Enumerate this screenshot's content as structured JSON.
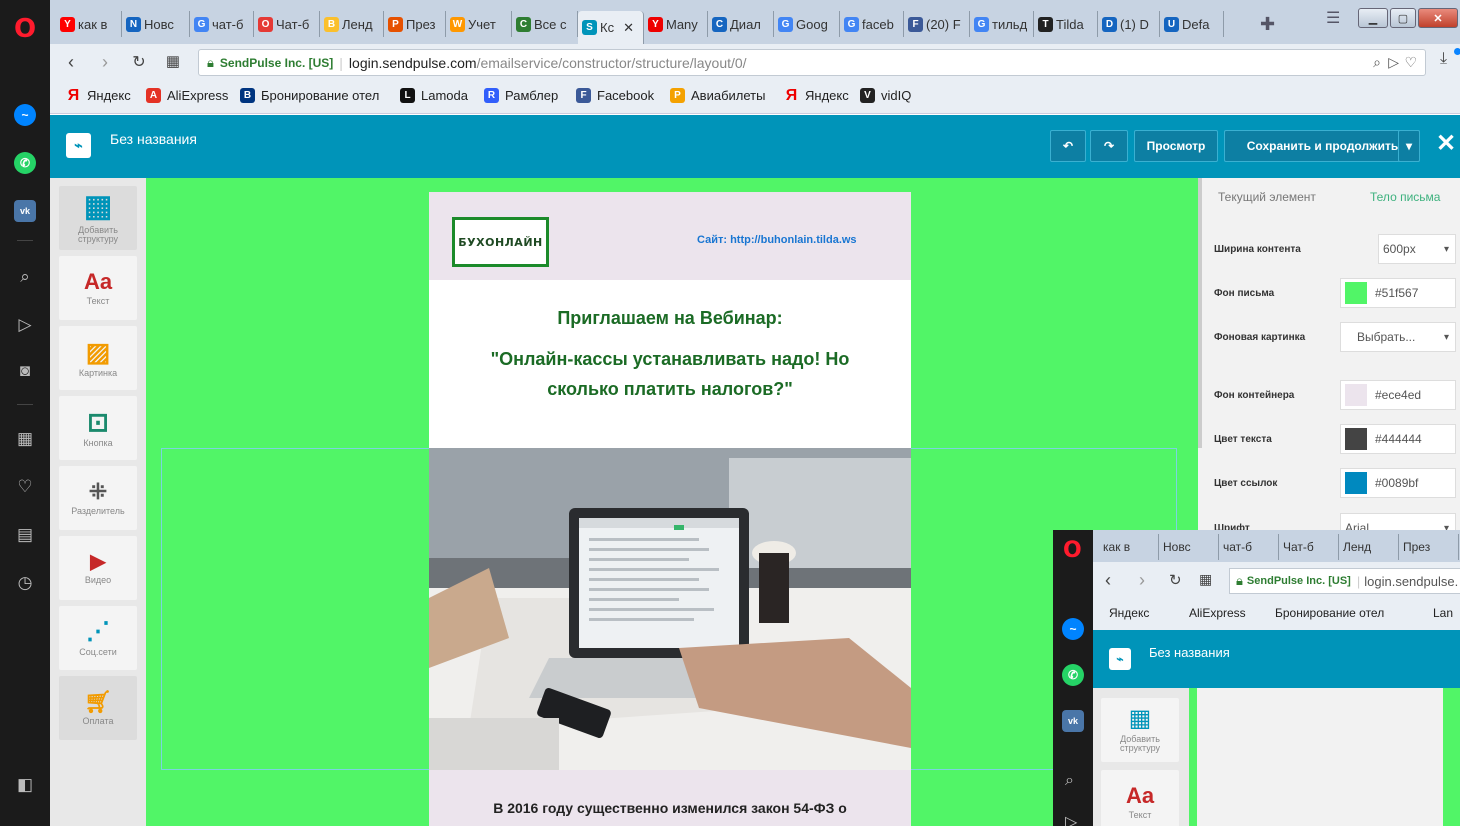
{
  "tabs": [
    {
      "label": "как в",
      "fav": "yandex-icon",
      "color": "#ff0000"
    },
    {
      "label": "Новс",
      "fav": "news-icon",
      "color": "#1565c0"
    },
    {
      "label": "чат-б",
      "fav": "google-icon",
      "color": "#4285f4"
    },
    {
      "label": "Чат-б",
      "fav": "opera-icon",
      "color": "#e53935"
    },
    {
      "label": "Ленд",
      "fav": "bulb-icon",
      "color": "#fbc02d"
    },
    {
      "label": "През",
      "fav": "presentation-icon",
      "color": "#e65100"
    },
    {
      "label": "Учет",
      "fav": "windows-icon",
      "color": "#ff9800"
    },
    {
      "label": "Все с",
      "fav": "check-icon",
      "color": "#2e7d32"
    },
    {
      "label": "Кс",
      "fav": "sendpulse-icon",
      "color": "#0094b9"
    },
    {
      "label": "Many",
      "fav": "youtube-icon",
      "color": "#e00"
    },
    {
      "label": "Диал",
      "fav": "chat-icon",
      "color": "#1565c0"
    },
    {
      "label": "Goog",
      "fav": "google-ads-icon",
      "color": "#4285f4"
    },
    {
      "label": "faceb",
      "fav": "google-icon",
      "color": "#4285f4"
    },
    {
      "label": "(20) F",
      "fav": "facebook-icon",
      "color": "#3b5998"
    },
    {
      "label": "тильд",
      "fav": "google-icon",
      "color": "#4285f4"
    },
    {
      "label": "Tilda",
      "fav": "tilda-icon",
      "color": "#222"
    },
    {
      "label": "(1) D",
      "fav": "doc-icon",
      "color": "#1565c0"
    },
    {
      "label": "Defa",
      "fav": "users-icon",
      "color": "#1565c0"
    }
  ],
  "address": {
    "secure_label": "SendPulse Inc. [US]",
    "url_host": "login.sendpulse.com",
    "url_path": "/emailservice/constructor/structure/layout/0/"
  },
  "bookmarks": [
    {
      "label": "Яндекс",
      "icon": "yandex-icon"
    },
    {
      "label": "AliExpress",
      "icon": "aliexpress-icon"
    },
    {
      "label": "Бронирование отел",
      "icon": "booking-icon"
    },
    {
      "label": "Lamoda",
      "icon": "lamoda-icon"
    },
    {
      "label": "Рамблер",
      "icon": "rambler-icon"
    },
    {
      "label": "Facebook",
      "icon": "facebook-icon"
    },
    {
      "label": "Авиабилеты",
      "icon": "plane-icon"
    },
    {
      "label": "Яндекс",
      "icon": "yandex-icon"
    },
    {
      "label": "vidIQ",
      "icon": "vidiq-icon"
    }
  ],
  "app": {
    "title": "Без названия",
    "undo": "↶",
    "redo": "↷",
    "preview": "Просмотр",
    "save": "Сохранить и продолжить",
    "close": "✕"
  },
  "tools": [
    {
      "label": "Добавить структуру",
      "icon": "grid-icon"
    },
    {
      "label": "Текст",
      "icon": "text-icon"
    },
    {
      "label": "Картинка",
      "icon": "image-icon"
    },
    {
      "label": "Кнопка",
      "icon": "button-icon"
    },
    {
      "label": "Разделитель",
      "icon": "divider-icon"
    },
    {
      "label": "Видео",
      "icon": "video-icon"
    },
    {
      "label": "Соц.сети",
      "icon": "share-icon"
    },
    {
      "label": "Оплата",
      "icon": "cart-icon"
    }
  ],
  "email": {
    "logo": "БУХОНЛАЙН",
    "site": "Сайт: http://buhonlain.tilda.ws",
    "heading1": "Приглашаем на Вебинар:",
    "heading2": "\"Онлайн-кассы устанавливать надо! Но сколько платить налогов?\"",
    "footer_text": "В 2016 году существенно изменился закон 54-ФЗ о"
  },
  "panel": {
    "tab_current": "Текущий элемент",
    "tab_body": "Тело письма",
    "rows": [
      {
        "label": "Ширина контента",
        "value": "600px"
      },
      {
        "label": "Фон письма",
        "value": "#51f567",
        "color": "#51f567"
      },
      {
        "label": "Фоновая картинка",
        "value": "Выбрать..."
      },
      {
        "label": "Фон контейнера",
        "value": "#ece4ed",
        "color": "#ece4ed"
      },
      {
        "label": "Цвет текста",
        "value": "#444444",
        "color": "#444444"
      },
      {
        "label": "Цвет ссылок",
        "value": "#0089bf",
        "color": "#0089bf"
      },
      {
        "label": "Шрифт",
        "value": "Arial"
      }
    ]
  },
  "mini": {
    "tabs": [
      "как в",
      "Новс",
      "чат-б",
      "Чат-б",
      "Ленд",
      "През"
    ],
    "secure_label": "SendPulse Inc. [US]",
    "url": "login.sendpulse.",
    "bookmarks": [
      "Яндекс",
      "AliExpress",
      "Бронирование отел",
      "Lan"
    ],
    "title": "Без названия",
    "tool1": "Добавить структуру",
    "tool2": "Текст"
  }
}
